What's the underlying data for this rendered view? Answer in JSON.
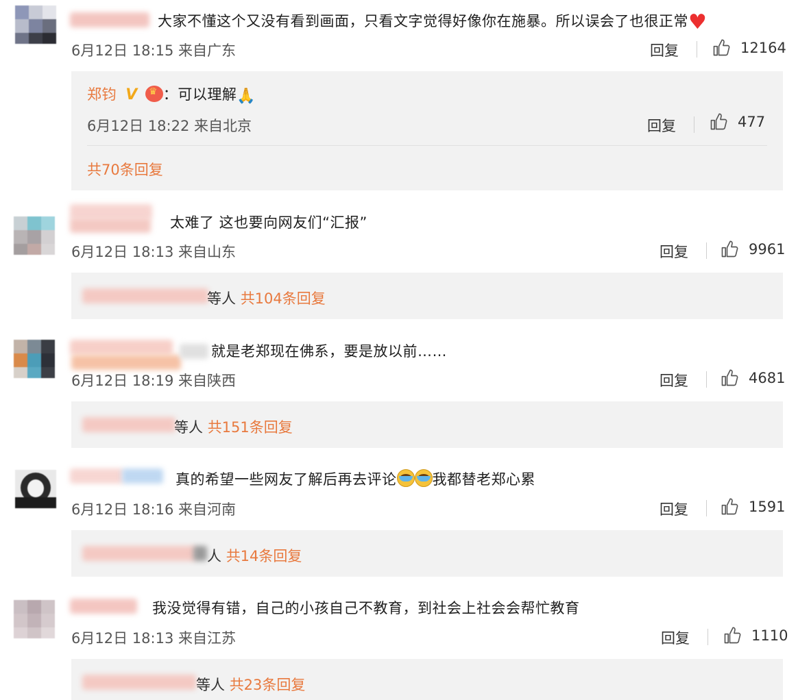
{
  "comments": [
    {
      "text": "大家不懂这个又没有看到画面，只看文字觉得好像你在施暴。所以误会了也很正常",
      "date": "6月12日",
      "time": "18:15",
      "location": "来自广东",
      "reply_label": "回复",
      "likes": "12164",
      "sub_reply": {
        "author": "郑钧",
        "badge": "V",
        "colon": "：",
        "text": "可以理解",
        "date": "6月12日",
        "time": "18:22",
        "location": "来自北京",
        "reply_label": "回复",
        "likes": "477"
      },
      "total_replies": "共70条回复"
    },
    {
      "text": "太难了 这也要向网友们“汇报”",
      "date": "6月12日",
      "time": "18:13",
      "location": "来自山东",
      "reply_label": "回复",
      "likes": "9961",
      "replies_prefix": "等人",
      "total_replies": "共104条回复"
    },
    {
      "text": "就是老郑现在佛系，要是放以前……",
      "date": "6月12日",
      "time": "18:19",
      "location": "来自陕西",
      "reply_label": "回复",
      "likes": "4681",
      "replies_prefix": "等人",
      "total_replies": "共151条回复"
    },
    {
      "text_a": "真的希望一些网友了解后再去评论",
      "text_b": "我都替老郑心累",
      "date": "6月12日",
      "time": "18:16",
      "location": "来自河南",
      "reply_label": "回复",
      "likes": "1591",
      "replies_prefix": "人",
      "total_replies": "共14条回复"
    },
    {
      "text": "我没觉得有错，自己的小孩自己不教育，到社会上社会会帮忙教育",
      "date": "6月12日",
      "time": "18:13",
      "location": "来自江苏",
      "reply_label": "回复",
      "likes": "1110",
      "replies_prefix": "等人",
      "total_replies": "共23条回复"
    }
  ],
  "icons": {
    "like": "thumbs-up-icon",
    "heart": "heart-emoji",
    "pray": "pray-emoji",
    "cry": "crying-laugh-emoji"
  },
  "colors": {
    "accent": "#e8793e",
    "panel": "#f2f2f2",
    "text": "#1f1f1f",
    "meta": "#555555"
  }
}
